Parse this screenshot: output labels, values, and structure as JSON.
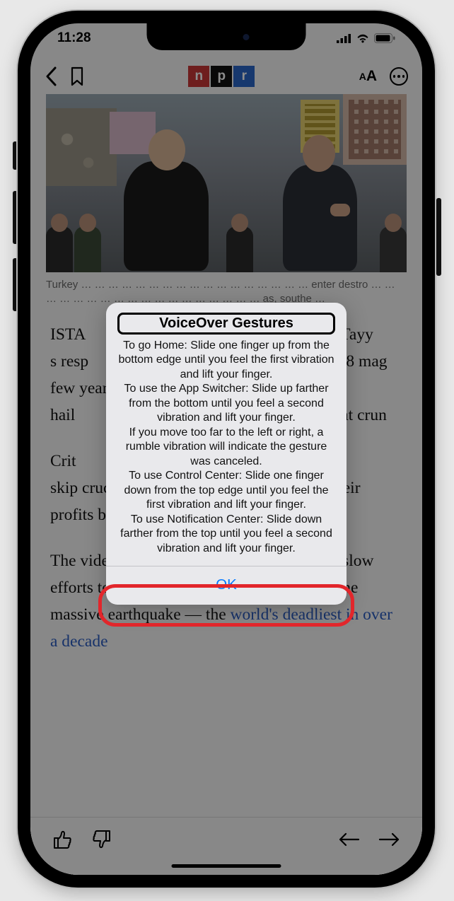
{
  "status": {
    "time": "11:28"
  },
  "nav": {
    "logo": {
      "n": "n",
      "p": "p",
      "r": "r"
    },
    "text_size_small": "A",
    "text_size_large": "A"
  },
  "caption": "Turkey … … … … … … … … … … … … … … … … … enter destro … … … … … … … … … … … … … … … … … … as, southe …",
  "article": {
    "p1_a": "ISTA",
    "p1_b": "ecep Tayy",
    "p1_c": "s resp",
    "p1_d": "7.8 mag",
    "p1_e": "few year",
    "p1_f": "hail",
    "p1_g": "at crun",
    "p2_a": "Crit",
    "p2_b": "skip crucial safety regulations, increasing their profits but putting residents at risk.",
    "p3": "The videos have fueled public outrage over slow efforts to help residents in the aftermath of the massive earthquake — the ",
    "p3_link": "world's deadliest in over a decade"
  },
  "alert": {
    "title": "VoiceOver Gestures",
    "body": "To go Home: Slide one finger up from the bottom edge until you feel the first vibration and lift your finger.\nTo use the App Switcher: Slide up farther from the bottom until you feel a second vibration and lift your finger.\nIf you move too far to the left or right, a rumble vibration will indicate the gesture was canceled.\nTo use Control Center: Slide one finger down from the top edge until you feel the first vibration and lift your finger.\nTo use Notification Center: Slide down farther from the top until you feel a second vibration and lift your finger.",
    "ok": "OK"
  }
}
